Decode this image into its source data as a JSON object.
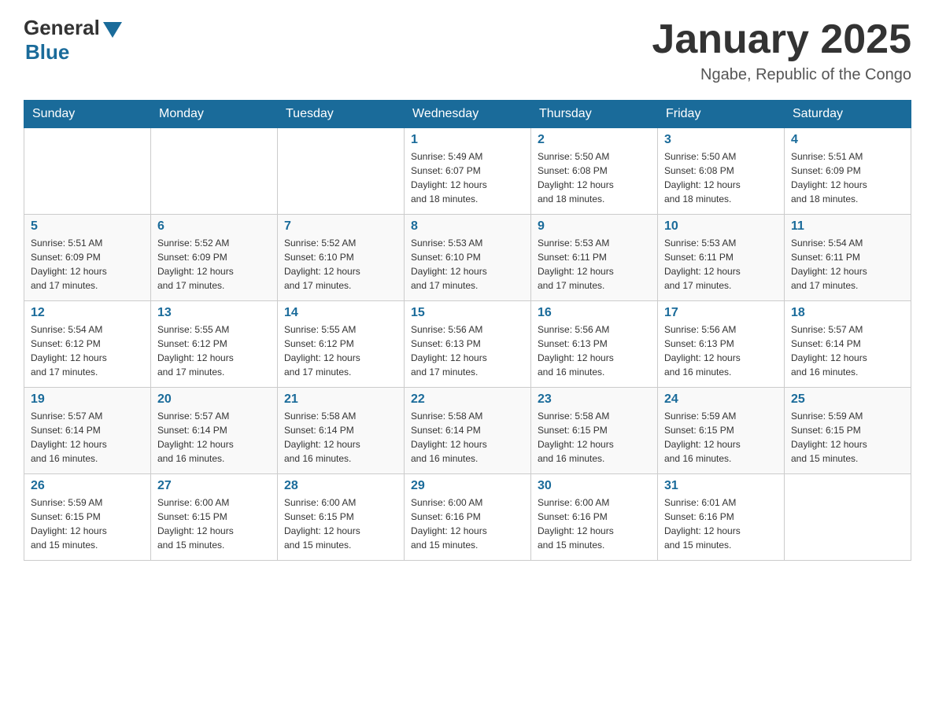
{
  "header": {
    "logo_general": "General",
    "logo_blue": "Blue",
    "month_title": "January 2025",
    "location": "Ngabe, Republic of the Congo"
  },
  "days_of_week": [
    "Sunday",
    "Monday",
    "Tuesday",
    "Wednesday",
    "Thursday",
    "Friday",
    "Saturday"
  ],
  "weeks": [
    [
      {
        "day": "",
        "info": ""
      },
      {
        "day": "",
        "info": ""
      },
      {
        "day": "",
        "info": ""
      },
      {
        "day": "1",
        "info": "Sunrise: 5:49 AM\nSunset: 6:07 PM\nDaylight: 12 hours\nand 18 minutes."
      },
      {
        "day": "2",
        "info": "Sunrise: 5:50 AM\nSunset: 6:08 PM\nDaylight: 12 hours\nand 18 minutes."
      },
      {
        "day": "3",
        "info": "Sunrise: 5:50 AM\nSunset: 6:08 PM\nDaylight: 12 hours\nand 18 minutes."
      },
      {
        "day": "4",
        "info": "Sunrise: 5:51 AM\nSunset: 6:09 PM\nDaylight: 12 hours\nand 18 minutes."
      }
    ],
    [
      {
        "day": "5",
        "info": "Sunrise: 5:51 AM\nSunset: 6:09 PM\nDaylight: 12 hours\nand 17 minutes."
      },
      {
        "day": "6",
        "info": "Sunrise: 5:52 AM\nSunset: 6:09 PM\nDaylight: 12 hours\nand 17 minutes."
      },
      {
        "day": "7",
        "info": "Sunrise: 5:52 AM\nSunset: 6:10 PM\nDaylight: 12 hours\nand 17 minutes."
      },
      {
        "day": "8",
        "info": "Sunrise: 5:53 AM\nSunset: 6:10 PM\nDaylight: 12 hours\nand 17 minutes."
      },
      {
        "day": "9",
        "info": "Sunrise: 5:53 AM\nSunset: 6:11 PM\nDaylight: 12 hours\nand 17 minutes."
      },
      {
        "day": "10",
        "info": "Sunrise: 5:53 AM\nSunset: 6:11 PM\nDaylight: 12 hours\nand 17 minutes."
      },
      {
        "day": "11",
        "info": "Sunrise: 5:54 AM\nSunset: 6:11 PM\nDaylight: 12 hours\nand 17 minutes."
      }
    ],
    [
      {
        "day": "12",
        "info": "Sunrise: 5:54 AM\nSunset: 6:12 PM\nDaylight: 12 hours\nand 17 minutes."
      },
      {
        "day": "13",
        "info": "Sunrise: 5:55 AM\nSunset: 6:12 PM\nDaylight: 12 hours\nand 17 minutes."
      },
      {
        "day": "14",
        "info": "Sunrise: 5:55 AM\nSunset: 6:12 PM\nDaylight: 12 hours\nand 17 minutes."
      },
      {
        "day": "15",
        "info": "Sunrise: 5:56 AM\nSunset: 6:13 PM\nDaylight: 12 hours\nand 17 minutes."
      },
      {
        "day": "16",
        "info": "Sunrise: 5:56 AM\nSunset: 6:13 PM\nDaylight: 12 hours\nand 16 minutes."
      },
      {
        "day": "17",
        "info": "Sunrise: 5:56 AM\nSunset: 6:13 PM\nDaylight: 12 hours\nand 16 minutes."
      },
      {
        "day": "18",
        "info": "Sunrise: 5:57 AM\nSunset: 6:14 PM\nDaylight: 12 hours\nand 16 minutes."
      }
    ],
    [
      {
        "day": "19",
        "info": "Sunrise: 5:57 AM\nSunset: 6:14 PM\nDaylight: 12 hours\nand 16 minutes."
      },
      {
        "day": "20",
        "info": "Sunrise: 5:57 AM\nSunset: 6:14 PM\nDaylight: 12 hours\nand 16 minutes."
      },
      {
        "day": "21",
        "info": "Sunrise: 5:58 AM\nSunset: 6:14 PM\nDaylight: 12 hours\nand 16 minutes."
      },
      {
        "day": "22",
        "info": "Sunrise: 5:58 AM\nSunset: 6:14 PM\nDaylight: 12 hours\nand 16 minutes."
      },
      {
        "day": "23",
        "info": "Sunrise: 5:58 AM\nSunset: 6:15 PM\nDaylight: 12 hours\nand 16 minutes."
      },
      {
        "day": "24",
        "info": "Sunrise: 5:59 AM\nSunset: 6:15 PM\nDaylight: 12 hours\nand 16 minutes."
      },
      {
        "day": "25",
        "info": "Sunrise: 5:59 AM\nSunset: 6:15 PM\nDaylight: 12 hours\nand 15 minutes."
      }
    ],
    [
      {
        "day": "26",
        "info": "Sunrise: 5:59 AM\nSunset: 6:15 PM\nDaylight: 12 hours\nand 15 minutes."
      },
      {
        "day": "27",
        "info": "Sunrise: 6:00 AM\nSunset: 6:15 PM\nDaylight: 12 hours\nand 15 minutes."
      },
      {
        "day": "28",
        "info": "Sunrise: 6:00 AM\nSunset: 6:15 PM\nDaylight: 12 hours\nand 15 minutes."
      },
      {
        "day": "29",
        "info": "Sunrise: 6:00 AM\nSunset: 6:16 PM\nDaylight: 12 hours\nand 15 minutes."
      },
      {
        "day": "30",
        "info": "Sunrise: 6:00 AM\nSunset: 6:16 PM\nDaylight: 12 hours\nand 15 minutes."
      },
      {
        "day": "31",
        "info": "Sunrise: 6:01 AM\nSunset: 6:16 PM\nDaylight: 12 hours\nand 15 minutes."
      },
      {
        "day": "",
        "info": ""
      }
    ]
  ]
}
